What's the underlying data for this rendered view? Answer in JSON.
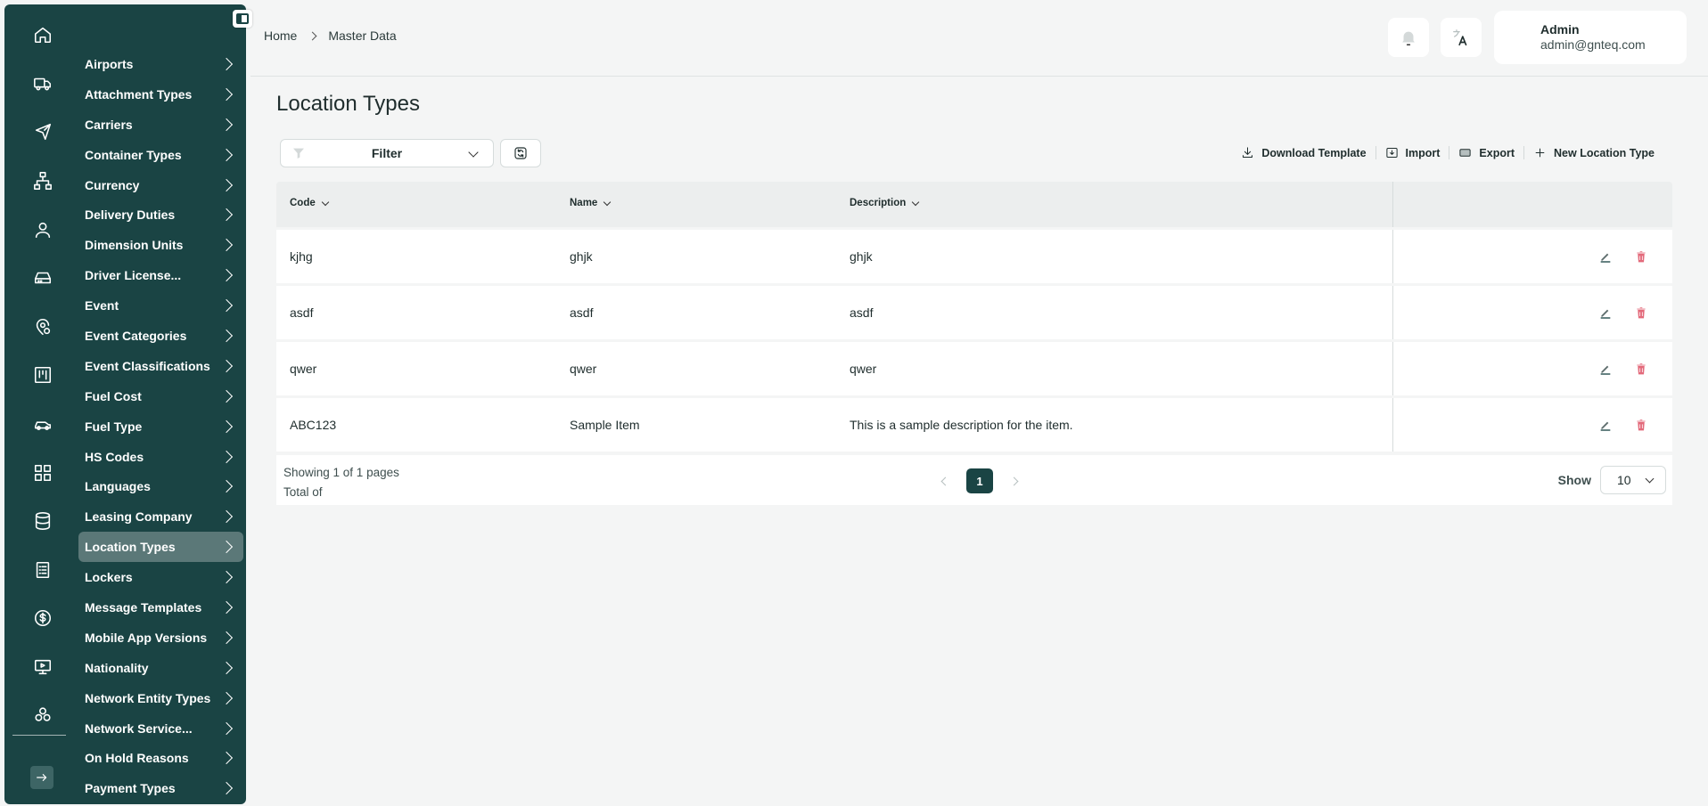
{
  "sidebar": {
    "rail_icons": [
      "home-icon",
      "truck-icon",
      "plane-icon",
      "network-icon",
      "user-icon",
      "hard-drive-icon",
      "location-settings-icon",
      "kanban-icon",
      "car-icon",
      "dashboard-icon",
      "database-icon",
      "receipt-icon",
      "dollar-icon",
      "monitor-play-icon",
      "integrations-icon"
    ],
    "items": [
      {
        "label": "Airports"
      },
      {
        "label": "Attachment Types"
      },
      {
        "label": "Carriers"
      },
      {
        "label": "Container Types"
      },
      {
        "label": "Currency"
      },
      {
        "label": "Delivery Duties"
      },
      {
        "label": "Dimension Units"
      },
      {
        "label": "Driver License..."
      },
      {
        "label": "Event"
      },
      {
        "label": "Event Categories"
      },
      {
        "label": "Event Classifications"
      },
      {
        "label": "Fuel Cost"
      },
      {
        "label": "Fuel Type"
      },
      {
        "label": "HS Codes"
      },
      {
        "label": "Languages"
      },
      {
        "label": "Leasing Company"
      },
      {
        "label": "Location Types"
      },
      {
        "label": "Lockers"
      },
      {
        "label": "Message Templates"
      },
      {
        "label": "Mobile App Versions"
      },
      {
        "label": "Nationality"
      },
      {
        "label": "Network Entity Types"
      },
      {
        "label": "Network Service..."
      },
      {
        "label": "On Hold Reasons"
      },
      {
        "label": "Payment Types"
      }
    ],
    "active_item": "Location Types",
    "accent_color": "#1a4444"
  },
  "header": {
    "breadcrumb": {
      "home": "Home",
      "current": "Master Data"
    },
    "user": {
      "name": "Admin",
      "email": "admin@gnteq.com"
    }
  },
  "page": {
    "title": "Location Types",
    "filter_label": "Filter",
    "actions": {
      "download_template": "Download Template",
      "import": "Import",
      "export": "Export",
      "new": "New Location Type"
    }
  },
  "table": {
    "columns": [
      "Code",
      "Name",
      "Description"
    ],
    "rows": [
      {
        "code": "kjhg",
        "name": "ghjk",
        "description": "ghjk"
      },
      {
        "code": "asdf",
        "name": "asdf",
        "description": "asdf"
      },
      {
        "code": "qwer",
        "name": "qwer",
        "description": "qwer"
      },
      {
        "code": "ABC123",
        "name": "Sample Item",
        "description": "This is a sample description for the item."
      }
    ]
  },
  "pagination": {
    "showing": "Showing 1 of 1 pages",
    "total": "Total of",
    "current_page": "1",
    "show_label": "Show",
    "page_size": "10"
  }
}
